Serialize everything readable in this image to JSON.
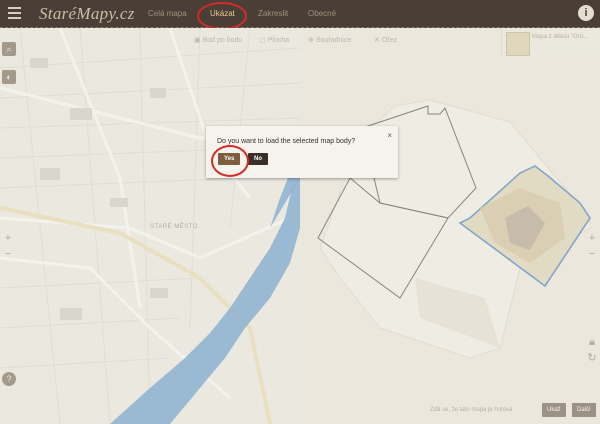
{
  "app": {
    "logo": "StaréMapy.cz",
    "nav": [
      {
        "label": "Celá mapa"
      },
      {
        "label": "Ukázat"
      },
      {
        "label": "Zakreslit"
      },
      {
        "label": "Obecné"
      }
    ],
    "info_icon": "info-icon",
    "menu_icon": "hamburger-icon"
  },
  "toolbar": {
    "items": [
      {
        "label": "Bod po bodu",
        "icon": "marker-icon"
      },
      {
        "label": "Plocha",
        "icon": "polygon-icon"
      },
      {
        "label": "Souřadnice",
        "icon": "crosshair-icon"
      },
      {
        "label": "Ořez",
        "icon": "crop-icon"
      }
    ]
  },
  "thumbnail": {
    "label": "Mapa z atlasu \"Grü..."
  },
  "map": {
    "district_label": "STARÉ MĚSTO"
  },
  "bottom": {
    "question": "Zdá se, že tato mapa je hotová",
    "yes_label": "Ukaž",
    "no_label": "Další"
  },
  "dialog": {
    "message": "Do you want to load the selected map body?",
    "yes_label": "Yes",
    "no_label": "No",
    "close_symbol": "×"
  },
  "colors": {
    "topbar": "#4a3f36",
    "accent": "#e8c98e",
    "highlight": "#d42a2a",
    "river": "#3e82c6",
    "selection": "#2f6fb4"
  }
}
